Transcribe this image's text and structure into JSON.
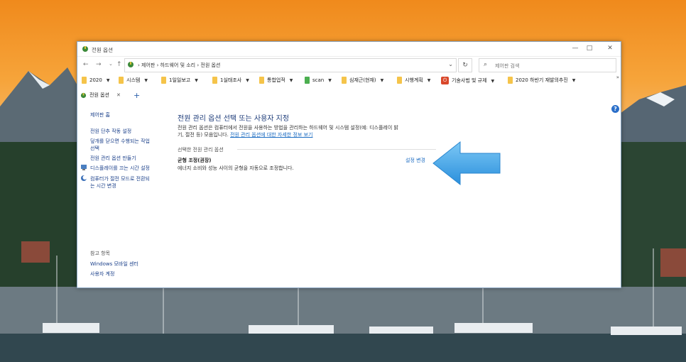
{
  "window": {
    "title": "전원 옵션",
    "minimize": "—",
    "maximize": "□",
    "close": "✕"
  },
  "nav": {
    "back": "←",
    "forward": "→",
    "up": "↑",
    "breadcrumb": "›  제어판  ›  하드웨어 및 소리  ›  전원 옵션",
    "dropdown": "⌄",
    "refresh": "↻",
    "search_placeholder": "제어판 검색"
  },
  "bookmarks": [
    {
      "label": "2020"
    },
    {
      "label": "시스템"
    },
    {
      "label": "1일일보고"
    },
    {
      "label": "1실태조사"
    },
    {
      "label": "통합업적"
    },
    {
      "label": "scan"
    },
    {
      "label": "심재근(현재)"
    },
    {
      "label": "시행계획"
    },
    {
      "label": "기술사법 및 규제"
    },
    {
      "label": "2020 하반기 재발의추진"
    }
  ],
  "bookmarks_more": "»",
  "tab": {
    "label": "전원 옵션",
    "close": "✕",
    "add": "+"
  },
  "sidebar": {
    "home": "제어판 홈",
    "links": [
      "전원 단추 작동 설정",
      "덮개를 닫으면 수행되는 작업",
      "선택",
      "전원 관리 옵션 만들기",
      "디스플레이를 끄는 시간 설정",
      "컴퓨터가 절전 모드로 전환되",
      "는 시간 변경"
    ],
    "see_also": "참고 항목",
    "see_also_links": [
      "Windows 모바일 센터",
      "사용자 계정"
    ]
  },
  "main": {
    "title": "전원 관리 옵션 선택 또는 사용자 지정",
    "desc_line1": "전원 관리 옵션은 컴퓨터에서 전원을 사용하는 방법을 관리하는 하드웨어 및 시스템 설정(예: 디스플레이 밝",
    "desc_line2": "기, 절전 등) 모음입니다.",
    "desc_link": "전원 관리 옵션에 대한 자세한 정보 보기",
    "section": "선택한 전원 관리 옵션",
    "plan_name": "균형 조정(권장)",
    "plan_desc": "에너지 소비와 성능 사이의 균형을 자동으로 조정합니다.",
    "change_link": "설정 변경"
  },
  "help": "?",
  "colors": {
    "accent_link": "#1a6bc2",
    "title_blue": "#1b3a78",
    "arrow_blue": "#3aa2e6"
  }
}
